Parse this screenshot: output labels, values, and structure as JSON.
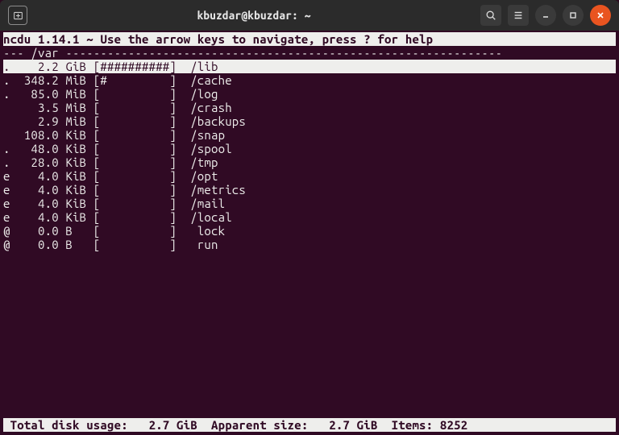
{
  "window": {
    "title": "kbuzdar@kbuzdar: ~"
  },
  "app": {
    "name": "ncdu",
    "version": "1.14.1",
    "help_hint": "Use the arrow keys to navigate, press ? for help"
  },
  "path": "/var",
  "rows": [
    {
      "flag": ".",
      "size": "2.2",
      "unit": "GiB",
      "bar": "##########",
      "name": "/lib",
      "selected": true
    },
    {
      "flag": ".",
      "size": "348.2",
      "unit": "MiB",
      "bar": "#         ",
      "name": "/cache",
      "selected": false
    },
    {
      "flag": ".",
      "size": "85.0",
      "unit": "MiB",
      "bar": "          ",
      "name": "/log",
      "selected": false
    },
    {
      "flag": " ",
      "size": "3.5",
      "unit": "MiB",
      "bar": "          ",
      "name": "/crash",
      "selected": false
    },
    {
      "flag": " ",
      "size": "2.9",
      "unit": "MiB",
      "bar": "          ",
      "name": "/backups",
      "selected": false
    },
    {
      "flag": " ",
      "size": "108.0",
      "unit": "KiB",
      "bar": "          ",
      "name": "/snap",
      "selected": false
    },
    {
      "flag": ".",
      "size": "48.0",
      "unit": "KiB",
      "bar": "          ",
      "name": "/spool",
      "selected": false
    },
    {
      "flag": ".",
      "size": "28.0",
      "unit": "KiB",
      "bar": "          ",
      "name": "/tmp",
      "selected": false
    },
    {
      "flag": "e",
      "size": "4.0",
      "unit": "KiB",
      "bar": "          ",
      "name": "/opt",
      "selected": false
    },
    {
      "flag": "e",
      "size": "4.0",
      "unit": "KiB",
      "bar": "          ",
      "name": "/metrics",
      "selected": false
    },
    {
      "flag": "e",
      "size": "4.0",
      "unit": "KiB",
      "bar": "          ",
      "name": "/mail",
      "selected": false
    },
    {
      "flag": "e",
      "size": "4.0",
      "unit": "KiB",
      "bar": "          ",
      "name": "/local",
      "selected": false
    },
    {
      "flag": "@",
      "size": "0.0",
      "unit": "B",
      "bar": "          ",
      "name": " lock",
      "selected": false
    },
    {
      "flag": "@",
      "size": "0.0",
      "unit": "B",
      "bar": "          ",
      "name": " run",
      "selected": false
    }
  ],
  "footer": {
    "total_label": "Total disk usage:",
    "total_value": "2.7 GiB",
    "apparent_label": "Apparent size:",
    "apparent_value": "2.7 GiB",
    "items_label": "Items:",
    "items_value": "8252"
  }
}
